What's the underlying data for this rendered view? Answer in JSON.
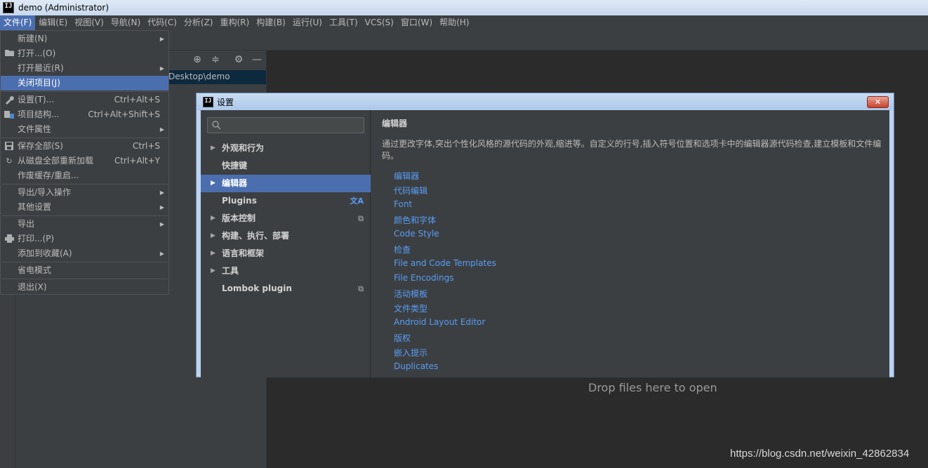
{
  "window": {
    "title": "demo (Administrator)",
    "app_icon_text": "IJ"
  },
  "menubar": {
    "items": [
      "文件(F)",
      "编辑(E)",
      "视图(V)",
      "导航(N)",
      "代码(C)",
      "分析(Z)",
      "重构(R)",
      "构建(B)",
      "运行(U)",
      "工具(T)",
      "VCS(S)",
      "窗口(W)",
      "帮助(H)"
    ]
  },
  "file_menu": {
    "items": [
      {
        "label": "新建(N)",
        "shortcut": "",
        "submenu": true,
        "icon": ""
      },
      {
        "label": "打开...(O)",
        "shortcut": "",
        "submenu": false,
        "icon": "folder-icon"
      },
      {
        "label": "打开最近(R)",
        "shortcut": "",
        "submenu": true,
        "icon": ""
      },
      {
        "label": "关闭项目(J)",
        "shortcut": "",
        "submenu": false,
        "icon": "",
        "selected": true
      },
      {
        "label": "设置(T)...",
        "shortcut": "Ctrl+Alt+S",
        "submenu": false,
        "icon": "wrench-icon"
      },
      {
        "label": "项目结构...",
        "shortcut": "Ctrl+Alt+Shift+S",
        "submenu": false,
        "icon": "project-structure-icon"
      },
      {
        "label": "文件属性",
        "shortcut": "",
        "submenu": true,
        "icon": ""
      },
      {
        "label": "保存全部(S)",
        "shortcut": "Ctrl+S",
        "submenu": false,
        "icon": "save-icon"
      },
      {
        "label": "从磁盘全部重新加载",
        "shortcut": "Ctrl+Alt+Y",
        "submenu": false,
        "icon": "reload-icon"
      },
      {
        "label": "作废缓存/重启...",
        "shortcut": "",
        "submenu": false,
        "icon": ""
      },
      {
        "label": "导出/导入操作",
        "shortcut": "",
        "submenu": true,
        "icon": ""
      },
      {
        "label": "其他设置",
        "shortcut": "",
        "submenu": true,
        "icon": ""
      },
      {
        "label": "导出",
        "shortcut": "",
        "submenu": true,
        "icon": ""
      },
      {
        "label": "打印...(P)",
        "shortcut": "",
        "submenu": false,
        "icon": "print-icon"
      },
      {
        "label": "添加到收藏(A)",
        "shortcut": "",
        "submenu": true,
        "icon": ""
      },
      {
        "label": "省电模式",
        "shortcut": "",
        "submenu": false,
        "icon": ""
      },
      {
        "label": "退出(X)",
        "shortcut": "",
        "submenu": false,
        "icon": ""
      }
    ]
  },
  "project_panel": {
    "path_text": "Desktop\\demo"
  },
  "editor": {
    "drop_hint": "Drop files here to open"
  },
  "settings_dialog": {
    "title": "设置",
    "close_label": "✕",
    "search_placeholder": "",
    "tree": [
      {
        "label": "外观和行为",
        "expandable": true,
        "badge": ""
      },
      {
        "label": "快捷键",
        "expandable": false,
        "badge": ""
      },
      {
        "label": "编辑器",
        "expandable": true,
        "badge": "",
        "selected": true
      },
      {
        "label": "Plugins",
        "expandable": false,
        "badge": "translate-icon"
      },
      {
        "label": "版本控制",
        "expandable": true,
        "badge": "copy-icon"
      },
      {
        "label": "构建、执行、部署",
        "expandable": true,
        "badge": ""
      },
      {
        "label": "语言和框架",
        "expandable": true,
        "badge": ""
      },
      {
        "label": "工具",
        "expandable": true,
        "badge": ""
      },
      {
        "label": "Lombok plugin",
        "expandable": false,
        "badge": "copy-icon"
      }
    ],
    "content": {
      "heading": "编辑器",
      "description": "通过更改字体,突出个性化风格的源代码的外观,缩进等。自定义的行号,插入符号位置和选项卡中的编辑器源代码检查,建立模板和文件编码。",
      "links": [
        "编辑器",
        "代码编辑",
        "Font",
        "颜色和字体",
        "Code Style",
        "检查",
        "File and Code Templates",
        "File Encodings",
        "活动模板",
        "文件类型",
        "Android Layout Editor",
        "版权",
        "嵌入提示",
        "Duplicates"
      ]
    }
  },
  "watermark": "https://blog.csdn.net/weixin_42862834",
  "colors": {
    "accent": "#4b6eaf",
    "link": "#589df6",
    "background": "#2b2b2b",
    "panel": "#3c3f41"
  }
}
